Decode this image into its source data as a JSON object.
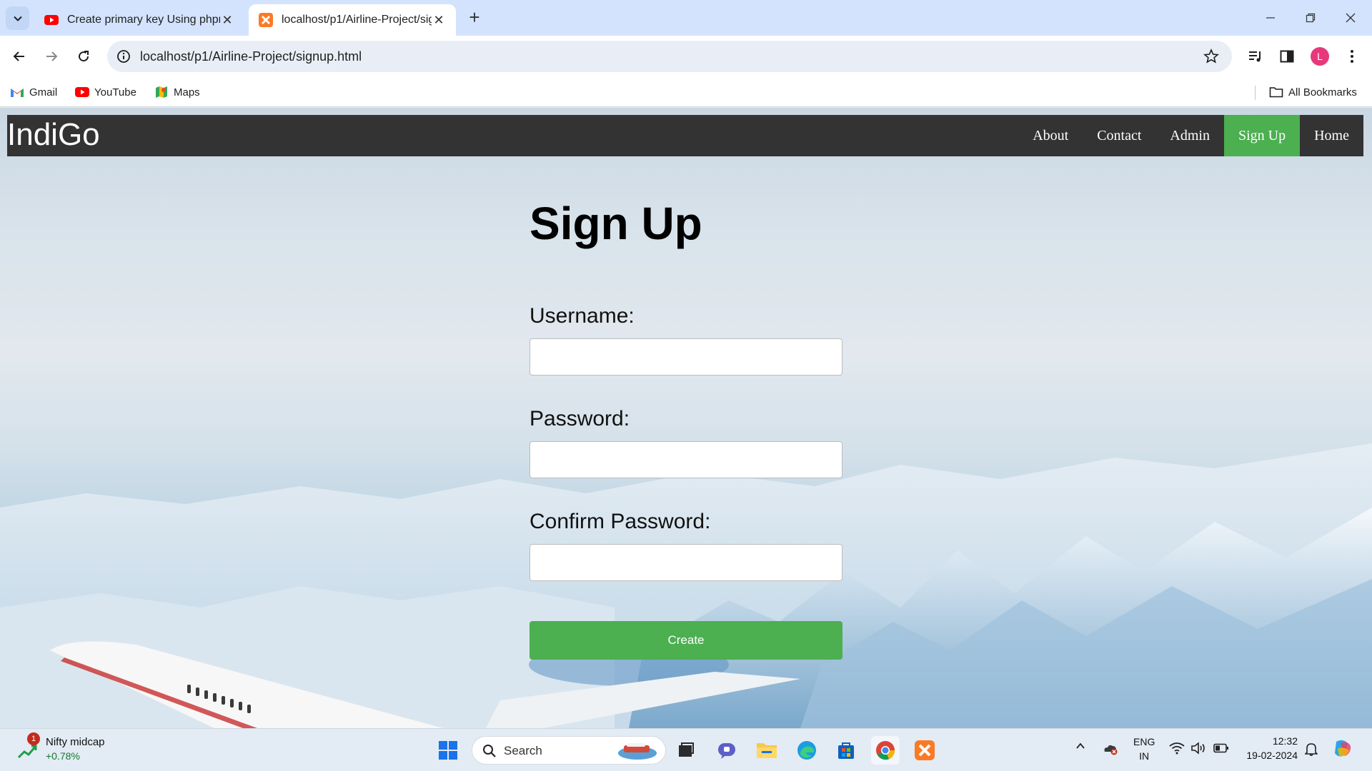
{
  "browser": {
    "tabs": [
      {
        "title": "Create primary key Using phpm",
        "active": false,
        "favicon": "youtube-icon"
      },
      {
        "title": "localhost/p1/Airline-Project/sig",
        "active": true,
        "favicon": "xampp-icon"
      }
    ],
    "url": "localhost/p1/Airline-Project/signup.html",
    "profile_initial": "L",
    "bookmarks": [
      {
        "label": "Gmail",
        "icon": "gmail-icon"
      },
      {
        "label": "YouTube",
        "icon": "youtube-icon"
      },
      {
        "label": "Maps",
        "icon": "maps-icon"
      }
    ],
    "all_bookmarks": "All Bookmarks"
  },
  "site": {
    "brand": "IndiGo",
    "nav": [
      {
        "label": "About",
        "active": false
      },
      {
        "label": "Contact",
        "active": false
      },
      {
        "label": "Admin",
        "active": false
      },
      {
        "label": "Sign Up",
        "active": true
      },
      {
        "label": "Home",
        "active": false
      }
    ],
    "colors": {
      "nav_bg": "#333333",
      "accent": "#4caf50"
    }
  },
  "form": {
    "title": "Sign Up",
    "username_label": "Username:",
    "username_value": "",
    "password_label": "Password:",
    "password_value": "",
    "confirm_label": "Confirm Password:",
    "confirm_value": "",
    "submit_label": "Create"
  },
  "taskbar": {
    "widget_title": "Nifty midcap",
    "widget_value": "+0.78%",
    "widget_badge": "1",
    "search_label": "Search",
    "lang_top": "ENG",
    "lang_bottom": "IN",
    "time": "12:32",
    "date": "19-02-2024"
  }
}
